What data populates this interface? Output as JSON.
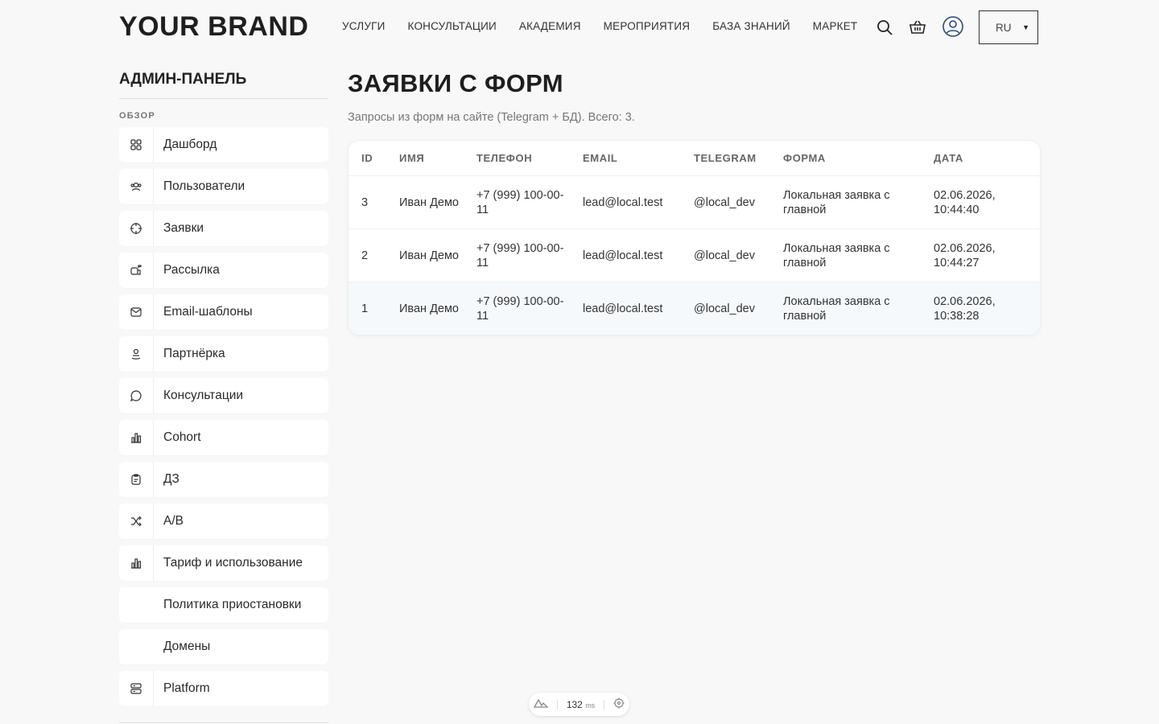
{
  "header": {
    "brand": "YOUR BRAND",
    "nav": [
      "УСЛУГИ",
      "КОНСУЛЬТАЦИИ",
      "АКАДЕМИЯ",
      "МЕРОПРИЯТИЯ",
      "БАЗА ЗНАНИЙ",
      "МАРКЕТ"
    ],
    "language": "RU",
    "icons": [
      "search-icon",
      "basket-icon",
      "user-icon"
    ]
  },
  "sidebar": {
    "title": "АДМИН-ПАНЕЛЬ",
    "section": "ОБЗОР",
    "items": [
      {
        "label": "Дашборд",
        "icon": "grid-icon"
      },
      {
        "label": "Пользователи",
        "icon": "users-icon"
      },
      {
        "label": "Заявки",
        "icon": "target-icon"
      },
      {
        "label": "Рассылка",
        "icon": "megaphone-icon"
      },
      {
        "label": "Email-шаблоны",
        "icon": "mail-icon"
      },
      {
        "label": "Партнёрка",
        "icon": "partner-icon"
      },
      {
        "label": "Консультации",
        "icon": "chat-icon"
      },
      {
        "label": "Cohort",
        "icon": "chart-icon"
      },
      {
        "label": "ДЗ",
        "icon": "clipboard-icon"
      },
      {
        "label": "A/B",
        "icon": "shuffle-icon"
      },
      {
        "label": "Тариф и использование",
        "icon": "chart-icon"
      },
      {
        "label": "Политика приостановки",
        "icon": ""
      },
      {
        "label": "Домены",
        "icon": ""
      },
      {
        "label": "Platform",
        "icon": "server-icon"
      }
    ]
  },
  "main": {
    "title": "ЗАЯВКИ С ФОРМ",
    "subtitle": "Запросы из форм на сайте (Telegram + БД). Всего: 3.",
    "table": {
      "headers": [
        "ID",
        "ИМЯ",
        "ТЕЛЕФОН",
        "EMAIL",
        "TELEGRAM",
        "ФОРМА",
        "ДАТА"
      ],
      "rows": [
        [
          "3",
          "Иван Демо",
          "+7 (999) 100-00-11",
          "lead@local.test",
          "@local_dev",
          "Локальная заявка с главной",
          "02.06.2026, 10:44:40"
        ],
        [
          "2",
          "Иван Демо",
          "+7 (999) 100-00-11",
          "lead@local.test",
          "@local_dev",
          "Локальная заявка с главной",
          "02.06.2026, 10:44:27"
        ],
        [
          "1",
          "Иван Демо",
          "+7 (999) 100-00-11",
          "lead@local.test",
          "@local_dev",
          "Локальная заявка с главной",
          "02.06.2026, 10:38:28"
        ]
      ]
    }
  },
  "perf": {
    "value": "132",
    "unit": "ms"
  }
}
